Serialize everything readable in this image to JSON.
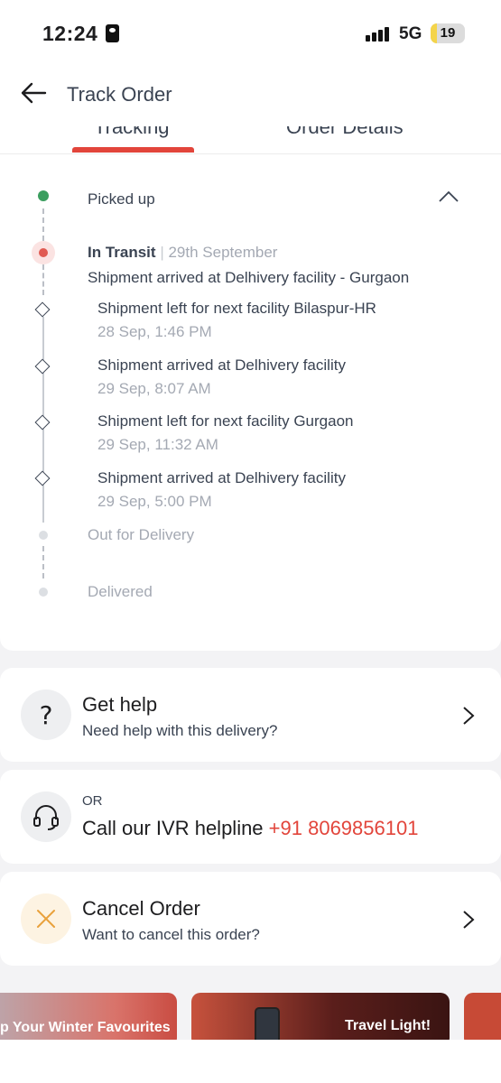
{
  "status_bar": {
    "time": "12:24",
    "network": "5G",
    "battery": "19",
    "battery_level": 0.19
  },
  "header": {
    "title": "Track Order"
  },
  "tabs": [
    {
      "label": "Tracking",
      "active": true
    },
    {
      "label": "Order Details",
      "active": false
    }
  ],
  "tracking": {
    "picked_up": "Picked up",
    "in_transit": {
      "label": "In Transit",
      "separator": "|",
      "date": "29th September",
      "detail": "Shipment arrived at Delhivery facility - Gurgaon"
    },
    "events": [
      {
        "text": "Shipment left for next facility Bilaspur-HR",
        "time": "28 Sep, 1:46 PM"
      },
      {
        "text": "Shipment arrived at Delhivery facility",
        "time": "29 Sep, 8:07 AM"
      },
      {
        "text": "Shipment left for next facility Gurgaon",
        "time": "29 Sep, 11:32 AM"
      },
      {
        "text": "Shipment arrived at Delhivery facility",
        "time": "29 Sep, 5:00 PM"
      }
    ],
    "out_for_delivery": "Out for Delivery",
    "delivered": "Delivered"
  },
  "help": {
    "title": "Get help",
    "subtitle": "Need help with this delivery?",
    "icon": "question-icon"
  },
  "ivr": {
    "or": "OR",
    "label": "Call our IVR helpline",
    "phone": "+91 8069856101",
    "icon": "headset-icon"
  },
  "cancel": {
    "title": "Cancel Order",
    "subtitle": "Want to cancel this order?",
    "icon": "close-icon"
  },
  "banners": [
    {
      "text": "p Your Winter Favourites"
    },
    {
      "text": "Travel Light!"
    }
  ],
  "colors": {
    "accent": "#e2453b",
    "green": "#3b9e5f"
  }
}
